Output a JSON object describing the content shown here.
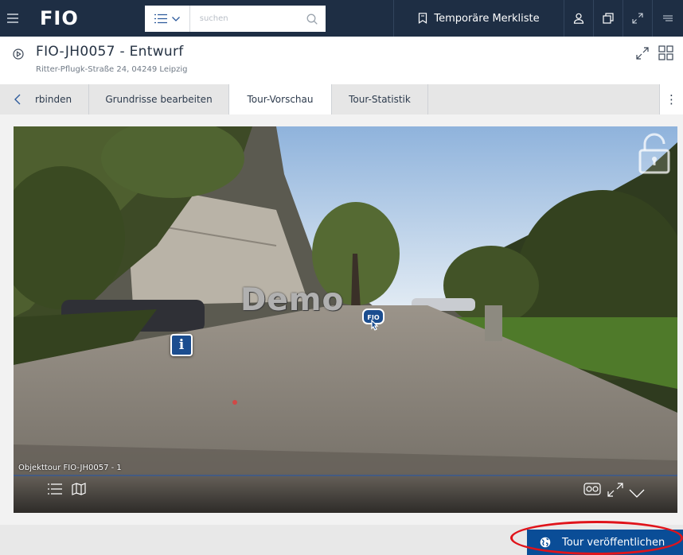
{
  "topbar": {
    "logo": "FIO",
    "search_placeholder": "suchen",
    "merkliste_label": "Temporäre Merkliste"
  },
  "header": {
    "title": "FIO-JH0057 - Entwurf",
    "address": "Ritter-Pflugk-Straße 24, 04249 Leipzig"
  },
  "tabs": [
    {
      "label": "rbinden",
      "active": false
    },
    {
      "label": "Grundrisse bearbeiten",
      "active": false
    },
    {
      "label": "Tour-Vorschau",
      "active": true
    },
    {
      "label": "Tour-Statistik",
      "active": false
    }
  ],
  "panorama": {
    "watermark": "Demo",
    "tour_label": "Objekttour FIO-JH0057 - 1",
    "hotspot_info": "i",
    "hotspot_fio": "FIO"
  },
  "footer": {
    "publish_label": "Tour veröffentlichen"
  },
  "colors": {
    "topbar": "#1e2e44",
    "accent": "#0a4d97",
    "highlight_ring": "#e0141b"
  }
}
